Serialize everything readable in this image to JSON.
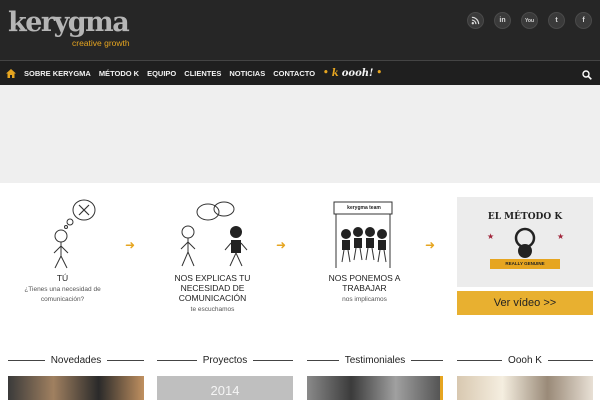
{
  "header": {
    "logo_main": "kerygma",
    "logo_sub": "creative growth",
    "social": [
      {
        "icon": "rss-icon",
        "glyph": "rss"
      },
      {
        "icon": "linkedin-icon",
        "glyph": "in"
      },
      {
        "icon": "youtube-icon",
        "glyph": "You"
      },
      {
        "icon": "twitter-icon",
        "glyph": "t"
      },
      {
        "icon": "facebook-icon",
        "glyph": "f"
      }
    ]
  },
  "nav": {
    "home_icon": "home-icon",
    "items": [
      "SOBRE KERYGMA",
      "MÉTODO K",
      "EQUIPO",
      "CLIENTES",
      "NOTICIAS",
      "CONTACTO"
    ],
    "oooh_k": "k",
    "oooh_text": "oooh!",
    "search_icon": "search-icon"
  },
  "steps": [
    {
      "title": "TÚ",
      "sub": "¿Tienes una necesidad de comunicación?"
    },
    {
      "title": "NOS EXPLICAS TU NECESIDAD DE COMUNICACIÓN",
      "sub": "te escuchamos"
    },
    {
      "title": "NOS PONEMOS A TRABAJAR",
      "sub": "nos implicamos",
      "sign": "kerygma team"
    }
  ],
  "metodo": {
    "title": "EL MÉTODO K",
    "ribbon": "REALLY GENUINE",
    "button": "Ver vídeo >>"
  },
  "sections": [
    "Novedades",
    "Proyectos",
    "Testimoniales",
    "Oooh K"
  ],
  "thumbs": {
    "proyectos_year": "2014"
  },
  "colors": {
    "accent": "#e6a520",
    "header_bg": "#262626",
    "nav_bg": "#1f1f1f"
  }
}
